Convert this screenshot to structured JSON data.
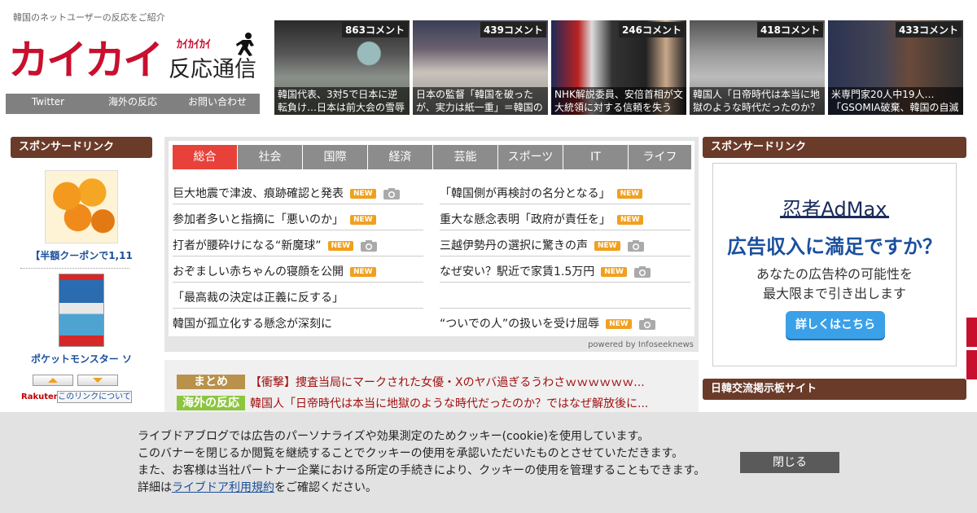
{
  "header": {
    "tagline": "韓国のネットユーザーの反応をご紹介",
    "logo_main": "カイカイ",
    "logo_kana": "ｶｲｶｲｶｲ",
    "logo_sub": "反応通信",
    "nav": [
      "Twitter",
      "海外の反応",
      "お問い合わせ"
    ]
  },
  "thumbs": [
    {
      "count": "863コメント",
      "caption": "韓国代表、3対5で日本に逆転負け…日本は前大会の雪辱"
    },
    {
      "count": "439コメント",
      "caption": "日本の監督「韓国を破ったが、実力は紙一重」＝韓国の"
    },
    {
      "count": "246コメント",
      "caption": "NHK解説委員、安倍首相が文大統領に対する信頼を失う"
    },
    {
      "count": "418コメント",
      "caption": "韓国人「日帝時代は本当に地獄のような時代だったのか？"
    },
    {
      "count": "433コメント",
      "caption": "米専門家20人中19人…「GSOMIA破棄、韓国の自滅"
    }
  ],
  "left_sidebar": {
    "heading": "スポンサードリンク",
    "products": [
      {
        "title": "【半額クーポンで1,11"
      },
      {
        "title": "ポケットモンスター ソ"
      }
    ],
    "rakuten": "Rakuten",
    "link_about": "このリンクについて"
  },
  "news": {
    "tabs": [
      "総合",
      "社会",
      "国際",
      "経済",
      "芸能",
      "スポーツ",
      "IT",
      "ライフ"
    ],
    "left": [
      {
        "text": "巨大地震で津波、痕跡確認と発表",
        "new": "NEW"
      },
      {
        "text": "参加者多いと指摘に「悪いのか」",
        "new": "NEW"
      },
      {
        "text": "打者が腰砕けになる“新魔球”",
        "new": "NEW"
      },
      {
        "text": "おぞましい赤ちゃんの寝顔を公開",
        "new": "NEW"
      },
      {
        "text": "「最高裁の決定は正義に反する」",
        "new": ""
      },
      {
        "text": "韓国が孤立化する懸念が深刻に",
        "new": ""
      }
    ],
    "right": [
      {
        "text": "「韓国側が再検討の名分となる」",
        "new": "NEW"
      },
      {
        "text": "重大な懸念表明「政府が責任を」",
        "new": "NEW"
      },
      {
        "text": "三越伊勢丹の選択に驚きの声",
        "new": "NEW"
      },
      {
        "text": "なぜ安い？駅近で家賃1.5万円",
        "new": "NEW"
      },
      {
        "text": "",
        "new": ""
      },
      {
        "text": "“ついでの人”の扱いを受け屈辱",
        "new": "NEW"
      }
    ],
    "powered": "powered by Infoseeknews"
  },
  "matome": [
    {
      "tag": "まとめ",
      "color": "#b8914a",
      "text": "【衝撃】捜査当局にマークされた女優・Xのヤバ過ぎるうわさｗｗｗｗｗｗ..."
    },
    {
      "tag": "海外の反応",
      "color": "#8cc63f",
      "text": "韓国人「日帝時代は本当に地獄のような時代だったのか？ではなぜ解放後に..."
    }
  ],
  "right_sidebar": {
    "heading1": "スポンサードリンク",
    "heading2": "日韓交流掲示板サイト",
    "ad": {
      "logo": "忍者AdMax",
      "headline": "広告収入に満足ですか？",
      "sub1": "あなたの広告枠の可能性を",
      "sub2": "最大限まで引き出します",
      "button": "詳しくはこちら"
    }
  },
  "cookie": {
    "line1": "ライブドアブログでは広告のパーソナライズや効果測定のためクッキー(cookie)を使用しています。",
    "line2": "このバナーを閉じるか閲覧を継続することでクッキーの使用を承認いただいたものとさせていただきます。",
    "line3": "また、お客様は当社パートナー企業における所定の手続きにより、クッキーの使用を管理することもできます。",
    "line4_pre": "詳細は",
    "line4_link": "ライブドア利用規約",
    "line4_post": "をご確認ください。",
    "close": "閉じる"
  }
}
